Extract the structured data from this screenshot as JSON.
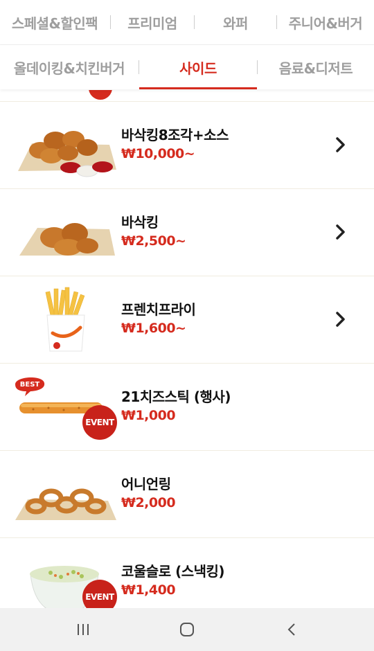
{
  "tabs_row1": [
    {
      "label": "스페셜&할인팩"
    },
    {
      "label": "프리미엄"
    },
    {
      "label": "와퍼"
    },
    {
      "label": "주니어&버거"
    }
  ],
  "tabs_row2": [
    {
      "label": "올데이킹&치킨버거"
    },
    {
      "label": "사이드",
      "active": true
    },
    {
      "label": "음료&디저트"
    }
  ],
  "products": [
    {
      "name": "바삭킹8조각+소스",
      "price": "₩10,000~",
      "badge": "",
      "has_chevron": true,
      "icon": "fried-chicken-8-pieces-image"
    },
    {
      "name": "바삭킹",
      "price": "₩2,500~",
      "badge": "",
      "has_chevron": true,
      "icon": "fried-chicken-image"
    },
    {
      "name": "프렌치프라이",
      "price": "₩1,600~",
      "badge": "",
      "has_chevron": true,
      "icon": "french-fries-image"
    },
    {
      "name": "21치즈스틱 (행사)",
      "price": "₩1,000",
      "badge": "EVENT",
      "best": "BEST",
      "has_chevron": false,
      "icon": "cheese-stick-image"
    },
    {
      "name": "어니언링",
      "price": "₩2,000",
      "badge": "",
      "has_chevron": false,
      "icon": "onion-rings-image"
    },
    {
      "name": "코울슬로 (스낵킹)",
      "price": "₩1,400",
      "badge": "EVENT",
      "has_chevron": false,
      "icon": "coleslaw-image"
    }
  ],
  "colors": {
    "accent": "#d52b1e",
    "inactive_tab": "#9e9e9e",
    "nav_bg": "#f1f1f1"
  },
  "navbar": {
    "icons": [
      "recent-apps-icon",
      "home-icon",
      "back-icon"
    ]
  }
}
